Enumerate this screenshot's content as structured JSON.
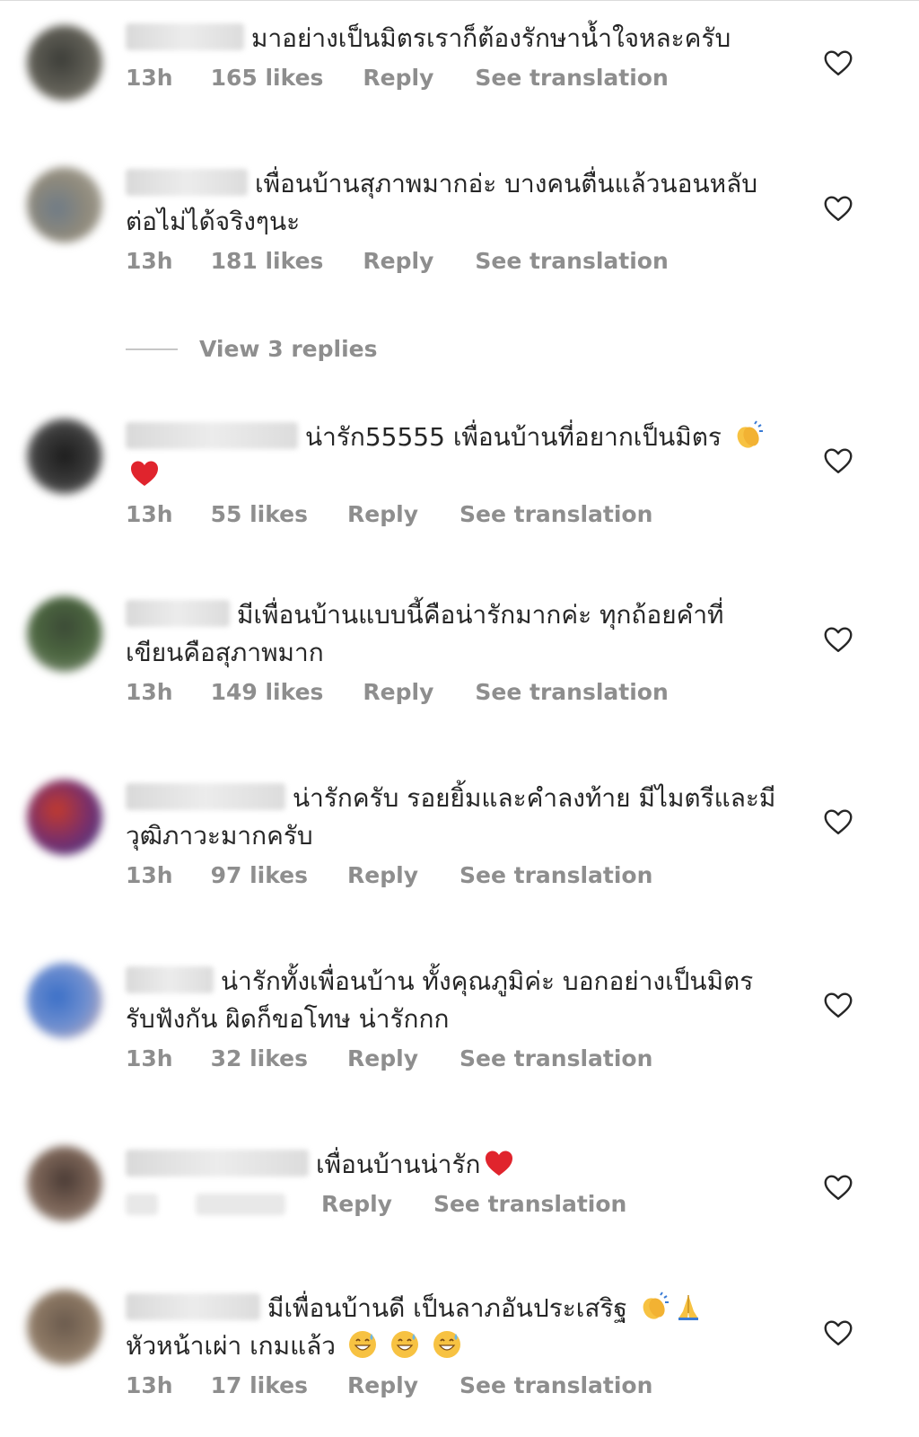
{
  "colors": {
    "text_primary": "#262626",
    "text_secondary": "#8e8e8e",
    "divider": "#dbdbdb",
    "heart_red": "#e0242d"
  },
  "comments": [
    {
      "text": "มาอย่างเป็นมิตรเราก็ต้องรักษาน้ำใจหละครับ",
      "time": "13h",
      "likes": "165 likes",
      "reply": "Reply",
      "translate": "See translation"
    },
    {
      "text": "เพื่อนบ้านสุภาพมากอ่ะ บางคนตื่นแล้วนอนหลับต่อไม่ได้จริงๆนะ",
      "time": "13h",
      "likes": "181 likes",
      "reply": "Reply",
      "translate": "See translation"
    },
    {
      "text": "น่ารัก55555 เพื่อนบ้านที่อยากเป็นมิตร",
      "time": "13h",
      "likes": "55 likes",
      "reply": "Reply",
      "translate": "See translation"
    },
    {
      "text": "มีเพื่อนบ้านแบบนี้คือน่ารักมากค่ะ ทุกถ้อยคำที่เขียนคือสุภาพมาก",
      "time": "13h",
      "likes": "149 likes",
      "reply": "Reply",
      "translate": "See translation"
    },
    {
      "text": "น่ารักครับ รอยยิ้มและคำลงท้าย มีไมตรีและมีวุฒิภาวะมากครับ",
      "time": "13h",
      "likes": "97 likes",
      "reply": "Reply",
      "translate": "See translation"
    },
    {
      "text": "น่ารักทั้งเพื่อนบ้าน ทั้งคุณภูมิค่ะ บอกอย่างเป็นมิตร รับฟังกัน ผิดก็ขอโทษ น่ารักกก",
      "time": "13h",
      "likes": "32 likes",
      "reply": "Reply",
      "translate": "See translation"
    },
    {
      "text": "เพื่อนบ้านน่ารัก",
      "reply": "Reply",
      "translate": "See translation"
    },
    {
      "text": "มีเพื่อนบ้านดี เป็นลาภอันประเสริฐ",
      "text_line2": "หัวหน้าเผ่า เกมแล้ว",
      "time": "13h",
      "likes": "17 likes",
      "reply": "Reply",
      "translate": "See translation"
    }
  ],
  "view_replies": "View 3 replies",
  "icons": {
    "like": "heart-outline-icon",
    "clap": "clapping-hands-emoji",
    "red_heart": "red-heart-emoji",
    "pray": "folded-hands-emoji",
    "sweat_smile": "grinning-sweat-emoji"
  }
}
